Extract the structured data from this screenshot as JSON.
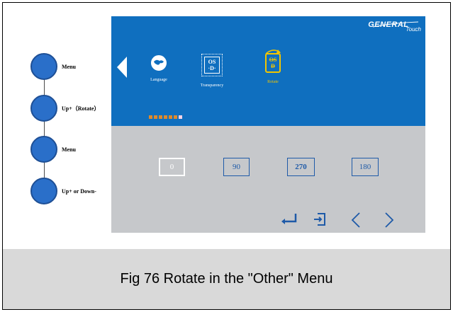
{
  "steps": [
    {
      "label": "Menu"
    },
    {
      "label": "Up+（Rotate）"
    },
    {
      "label": "Menu"
    },
    {
      "label": "Up+ or Down-"
    }
  ],
  "osd": {
    "brand": {
      "main": "GENERAL",
      "sub": "Touch"
    },
    "menu_items": [
      {
        "label": "Language",
        "icon": "globe-icon"
      },
      {
        "label": "Transparency",
        "icon": "osd-transparency-icon",
        "glyph_top": "OS",
        "glyph_bottom": "·D·"
      },
      {
        "label": "Rotate",
        "icon": "rotate-icon",
        "glyph_top": "OS",
        "glyph_bottom": "D",
        "selected": true
      }
    ],
    "page_indicator": {
      "count": 7,
      "active_index": 6
    },
    "angles": [
      {
        "label": "0",
        "selected": true
      },
      {
        "label": "90",
        "selected": false
      },
      {
        "label": "270",
        "selected": false
      },
      {
        "label": "180",
        "selected": false
      }
    ],
    "nav_icons": [
      "enter-icon",
      "exit-icon",
      "chevron-left-icon",
      "chevron-right-icon"
    ],
    "colors": {
      "top": "#0f6fbf",
      "bottom": "#c6c8cb",
      "selected_item": "#f1c500",
      "accent": "#1e5aa8"
    }
  },
  "caption": "Fig 76 Rotate in the \"Other\" Menu"
}
